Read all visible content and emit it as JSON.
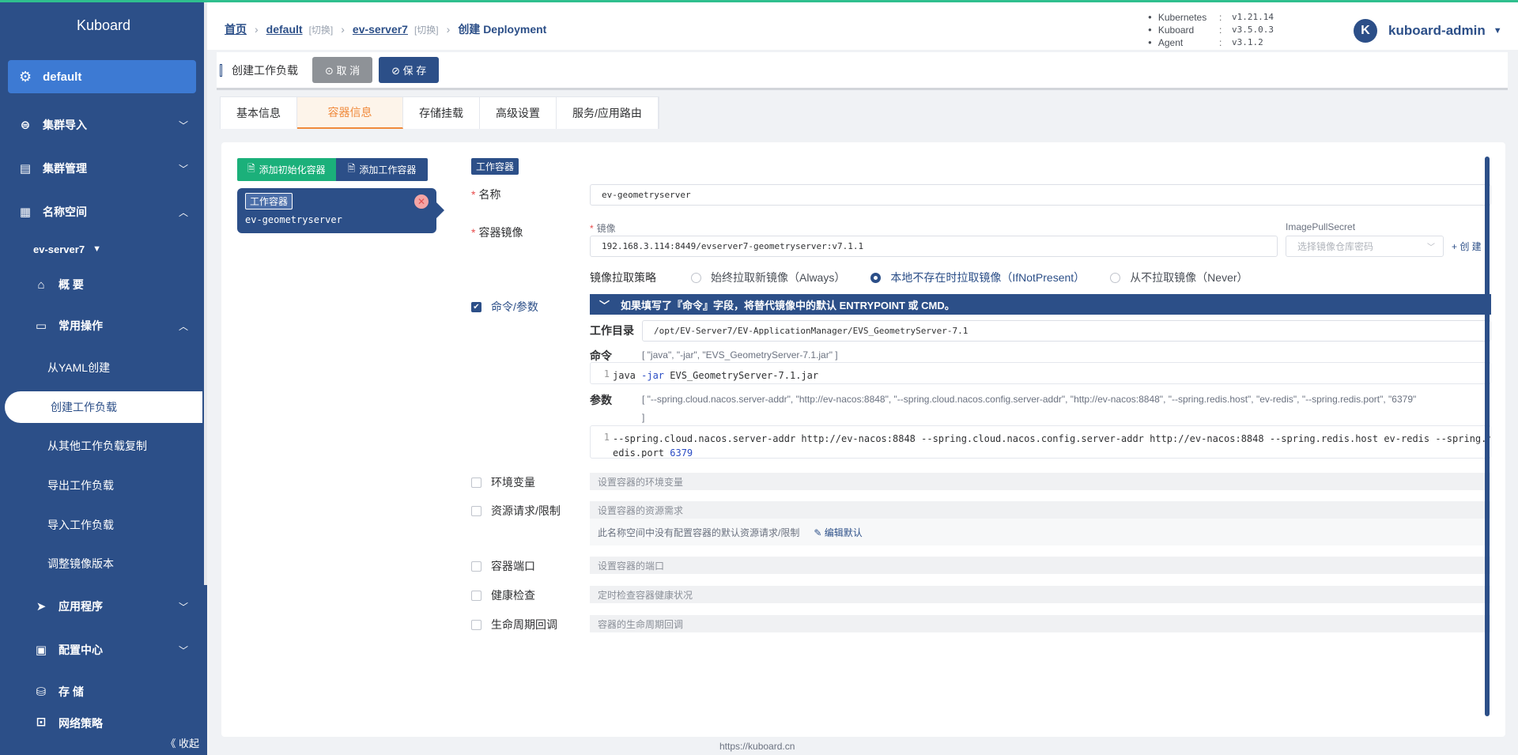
{
  "brand": "Kuboard",
  "sidebar": {
    "namespace": "default",
    "items": [
      {
        "label": "集群导入",
        "icon": "link-icon"
      },
      {
        "label": "集群管理",
        "icon": "server-icon"
      },
      {
        "label": "名称空间",
        "icon": "grid-icon"
      }
    ],
    "ns_name": "ev-server7",
    "overview": "概 要",
    "ops": "常用操作",
    "sub_items": [
      "从YAML创建",
      "创建工作负载",
      "从其他工作负载复制",
      "导出工作负载",
      "导入工作负载",
      "调整镜像版本"
    ],
    "lower": [
      "应用程序",
      "配置中心",
      "存 储",
      "网络策略"
    ],
    "collapse": "《 收起"
  },
  "breadcrumb": {
    "home": "首页",
    "cluster": "default",
    "cluster_switch": "[切换]",
    "ns": "ev-server7",
    "ns_switch": "[切换]",
    "current": "创建 Deployment"
  },
  "versions": [
    {
      "k": "Kubernetes",
      "v": "v1.21.14"
    },
    {
      "k": "Kuboard",
      "v": "v3.5.0.3"
    },
    {
      "k": "Agent",
      "v": "v3.1.2"
    }
  ],
  "user": {
    "initial": "K",
    "name": "kuboard-admin"
  },
  "toolbar": {
    "title": "创建工作负载",
    "cancel": "⊙ 取 消",
    "save": "⊘ 保 存"
  },
  "tabs": [
    "基本信息",
    "容器信息",
    "存储挂载",
    "高级设置",
    "服务/应用路由"
  ],
  "left": {
    "add_init": "添加初始化容器",
    "add_work": "添加工作容器",
    "card_tag": "工作容器",
    "card_name": "ev-geometryserver"
  },
  "form": {
    "type_badge": "工作容器",
    "name_label": "名称",
    "name_value": "ev-geometryserver",
    "image_label": "容器镜像",
    "image_sub": "镜像",
    "image_value": "192.168.3.114:8449/evserver7-geometryserver:v7.1.1",
    "pull_secret_label": "ImagePullSecret",
    "pull_secret_placeholder": "选择镜像仓库密码",
    "create": "+ 创 建",
    "pull_policy_label": "镜像拉取策略",
    "pull_options": [
      "始终拉取新镜像（Always）",
      "本地不存在时拉取镜像（IfNotPresent）",
      "从不拉取镜像（Never）"
    ],
    "pull_selected": 1,
    "cmd_label": "命令/参数",
    "cmd_notice": "如果填写了『命令』字段，将替代镜像中的默认 ENTRYPOINT 或 CMD。",
    "workdir_label": "工作目录",
    "workdir_value": "/opt/EV-Server7/EV-ApplicationManager/EVS_GeometryServer-7.1",
    "command_label": "命令",
    "command_hint": "[ \"java\", \"-jar\", \"EVS_GeometryServer-7.1.jar\" ]",
    "command_value_pre": "java ",
    "command_value_kw": "-jar",
    "command_value_post": " EVS_GeometryServer-7.1.jar",
    "args_label": "参数",
    "args_hint": "[ \"--spring.cloud.nacos.server-addr\", \"http://ev-nacos:8848\", \"--spring.cloud.nacos.config.server-addr\", \"http://ev-nacos:8848\", \"--spring.redis.host\", \"ev-redis\", \"--spring.redis.port\", \"6379\"",
    "args_hint_end": "]",
    "args_line1": "--spring.cloud.nacos.server-addr http://ev-nacos:8848 --spring.cloud.nacos.config.server-addr http://ev-nacos:8848 --spring.redis.host ev-redis --spring.r",
    "args_line2_a": "edis.port ",
    "args_line2_b": "6379",
    "env_label": "环境变量",
    "env_placeholder": "设置容器的环境变量",
    "res_label": "资源请求/限制",
    "res_placeholder": "设置容器的资源需求",
    "res_note": "此名称空间中没有配置容器的默认资源请求/限制",
    "res_edit": "编辑默认",
    "port_label": "容器端口",
    "port_placeholder": "设置容器的端口",
    "health_label": "健康检查",
    "health_placeholder": "定时检查容器健康状况",
    "life_label": "生命周期回调",
    "life_placeholder": "容器的生命周期回调"
  },
  "footer": "https://kuboard.cn",
  "colors": {
    "sidebar": "#2c4f88",
    "accent": "#3d7ad3",
    "green": "#1bb07a",
    "orange": "#f08a3c"
  }
}
